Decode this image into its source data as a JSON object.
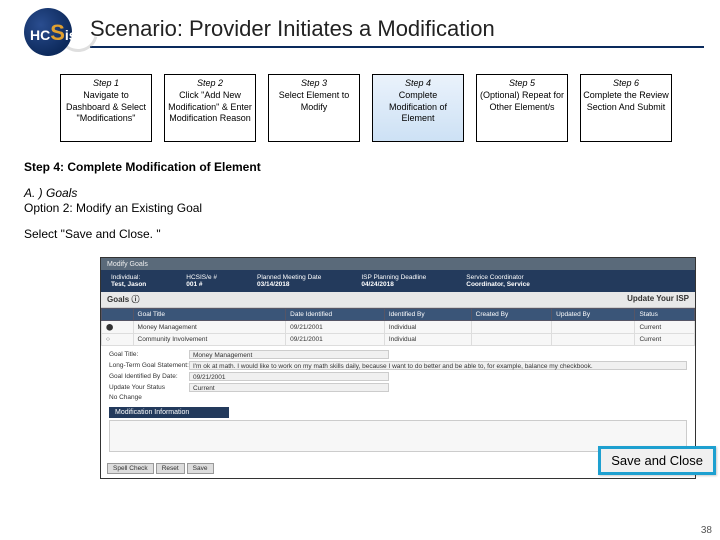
{
  "header": {
    "title": "Scenario: Provider Initiates a Modification"
  },
  "logo": {
    "text_left": "HC",
    "text_big": "S",
    "text_right": "is"
  },
  "steps": [
    {
      "title": "Step 1",
      "body": "Navigate to Dashboard & Select \"Modifications\""
    },
    {
      "title": "Step 2",
      "body": "Click \"Add New Modification\" & Enter Modification Reason"
    },
    {
      "title": "Step 3",
      "body": "Select Element to Modify"
    },
    {
      "title": "Step 4",
      "body": "Complete Modification of Element"
    },
    {
      "title": "Step 5",
      "body": "(Optional) Repeat for Other Element/s"
    },
    {
      "title": "Step 6",
      "body": "Complete the Review Section And Submit"
    }
  ],
  "body": {
    "step_hdr": "Step 4: Complete Modification of Element",
    "goals_hdr": "A. ) Goals",
    "option_line": "Option 2: Modify an Existing Goal",
    "select_line": "Select \"Save and Close. \""
  },
  "screenshot": {
    "topbar": "Modify Goals",
    "nav": {
      "individual_label": "Individual:",
      "individual_value": "Test, Jason",
      "mci_label": "HCSIS/e #",
      "mci_value": "001 #",
      "meeting_label": "Planned Meeting Date",
      "meeting_value": "03/14/2018",
      "deadline_label": "ISP Planning Deadline",
      "deadline_value": "04/24/2018",
      "sc_label": "Service Coordinator",
      "sc_value": "Coordinator, Service"
    },
    "section_hdr_left": "Goals ⓘ",
    "section_hdr_right": "Update Your ISP",
    "table": {
      "headers": [
        "",
        "Goal Title",
        "Date Identified",
        "Identified By",
        "Created By",
        "Updated By",
        "Status"
      ],
      "rows": [
        [
          "⬤",
          "Money Management",
          "09/21/2001",
          "Individual",
          "",
          "",
          "Current"
        ],
        [
          "○",
          "Community Involvement",
          "09/21/2001",
          "Individual",
          "",
          "",
          "Current"
        ]
      ]
    },
    "fields": {
      "goal_title_label": "Goal Title:",
      "goal_title_value": "Money Management",
      "longterm_label": "Long-Term Goal Statement:",
      "longterm_value": "I'm ok at math. I would like to work on my math skills daily, because I want to do better and be able to, for example, balance my checkbook.",
      "date_label": "Goal Identified By Date:",
      "date_value": "09/21/2001",
      "status_label": "Update Your Status",
      "status_value": "Current",
      "nochange_label": "No Change"
    },
    "modinfo_hdr": "Modification Information",
    "btns": {
      "spell": "Spell Check",
      "reset": "Reset",
      "save": "Save",
      "save_close": "Save and Close"
    }
  },
  "callout": {
    "save_close": "Save and Close"
  },
  "page_num": "38"
}
